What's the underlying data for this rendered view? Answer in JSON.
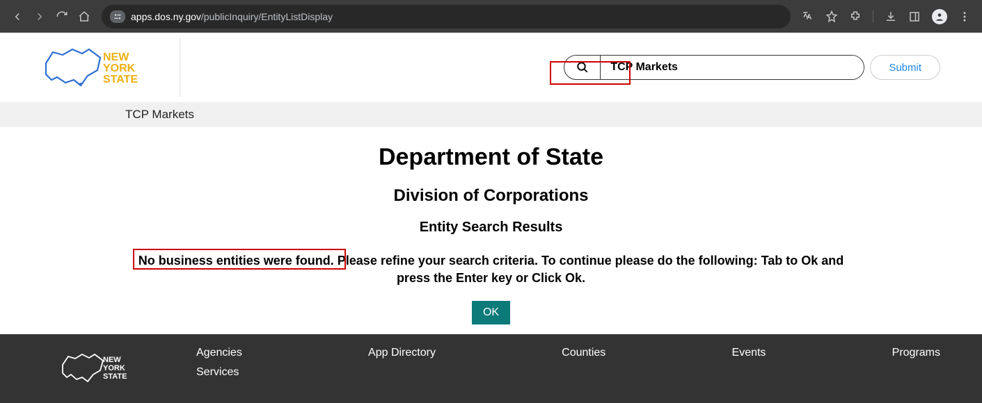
{
  "browser": {
    "url_host": "apps.dos.ny.gov",
    "url_path": "/publicInquiry/EntityListDisplay"
  },
  "header": {
    "logo_text": "NEW YORK STATE",
    "search_value": "TCP Markets",
    "submit_label": "Submit"
  },
  "term_bar": {
    "term": "TCP Markets"
  },
  "main": {
    "h1": "Department of State",
    "h2": "Division of Corporations",
    "h3": "Entity Search Results",
    "msg_lead": "No business entities were found.",
    "msg_rest_line1": " Please refine your search criteria. To continue please do the following: Tab to Ok and",
    "msg_rest_line2": "press the Enter key or Click Ok.",
    "ok_label": "OK"
  },
  "footer": {
    "links": {
      "agencies": "Agencies",
      "services": "Services",
      "app_directory": "App Directory",
      "counties": "Counties",
      "events": "Events",
      "programs": "Programs"
    }
  }
}
